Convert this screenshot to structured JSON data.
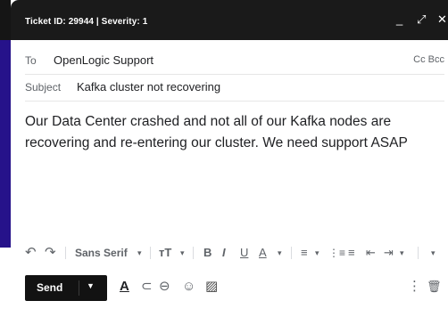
{
  "window": {
    "title": "Ticket ID: 29944 | Severity: 1",
    "minimize_glyph": "_",
    "expand_glyph": "⤢",
    "close_glyph": "✕"
  },
  "header": {
    "to_label": "To",
    "to_value": "OpenLogic Support",
    "cc_bcc": "Cc Bcc",
    "subject_label": "Subject",
    "subject_value": "Kafka cluster not recovering"
  },
  "message": {
    "body": "Our Data Center crashed and not all of our Kafka nodes are recovering and re-entering our cluster. We need support ASAP"
  },
  "format_toolbar": {
    "undo": "↶",
    "redo": "↷",
    "font": "Sans Serif",
    "caret": "▾",
    "size": "тT",
    "bold": "B",
    "italic": "I",
    "underline": "U",
    "text_color": "A",
    "align": "≡",
    "numbered": "⋮≡",
    "bulleted": "≡",
    "indent_less": "⇤",
    "indent_more": "⇥"
  },
  "bottom_toolbar": {
    "send_label": "Send",
    "send_caret": "▼",
    "format_glyph": "A",
    "attach_glyph": "⊂",
    "link_glyph": "⊖",
    "emoji_glyph": "☺",
    "photo_glyph": "▨",
    "more_glyph": "⋮",
    "trash_glyph": "🗑"
  },
  "colors": {
    "titlebar": "#1a1a1a",
    "side_accent": "#26128a",
    "send_button": "#121212"
  },
  "icons": [
    "minimize-icon",
    "expand-icon",
    "close-icon",
    "undo-icon",
    "redo-icon",
    "text-size-icon",
    "bold-icon",
    "italic-icon",
    "underline-icon",
    "text-color-icon",
    "align-icon",
    "numbered-list-icon",
    "bulleted-list-icon",
    "indent-less-icon",
    "indent-more-icon",
    "formatting-icon",
    "attach-icon",
    "link-icon",
    "emoji-icon",
    "photo-icon",
    "more-options-icon",
    "trash-icon"
  ]
}
